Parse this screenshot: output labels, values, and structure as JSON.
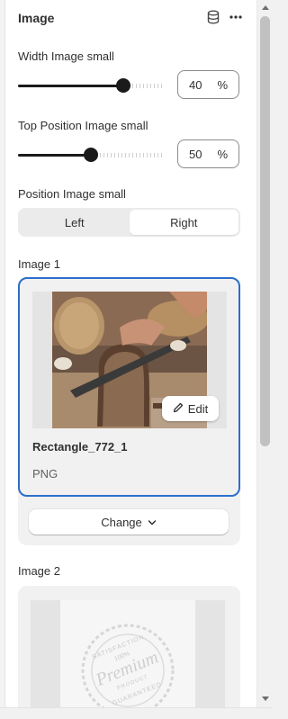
{
  "header": {
    "title": "Image",
    "db_icon": "database-icon",
    "more_icon": "more-horizontal-icon"
  },
  "width_control": {
    "label": "Width Image small",
    "value": "40",
    "unit": "%",
    "level_percent": 72
  },
  "top_control": {
    "label": "Top Position Image small",
    "value": "50",
    "unit": "%",
    "level_percent": 50
  },
  "position_control": {
    "label": "Position Image small",
    "options": [
      "Left",
      "Right"
    ],
    "selected": "Right"
  },
  "image1": {
    "label": "Image 1",
    "file_name": "Rectangle_772_1",
    "file_type": "PNG",
    "edit_label": "Edit",
    "change_label": "Change"
  },
  "image2": {
    "label": "Image 2",
    "seal_text_top": "SATISFACTION",
    "seal_text_main": "Premium",
    "seal_text_sub": "PRODUCT",
    "seal_text_bottom": "GUARANTEED",
    "seal_text_pct": "100%"
  },
  "colors": {
    "accent": "#2c6ecb",
    "slider": "#1a1a1a",
    "card_bg": "#f1f1f1"
  }
}
